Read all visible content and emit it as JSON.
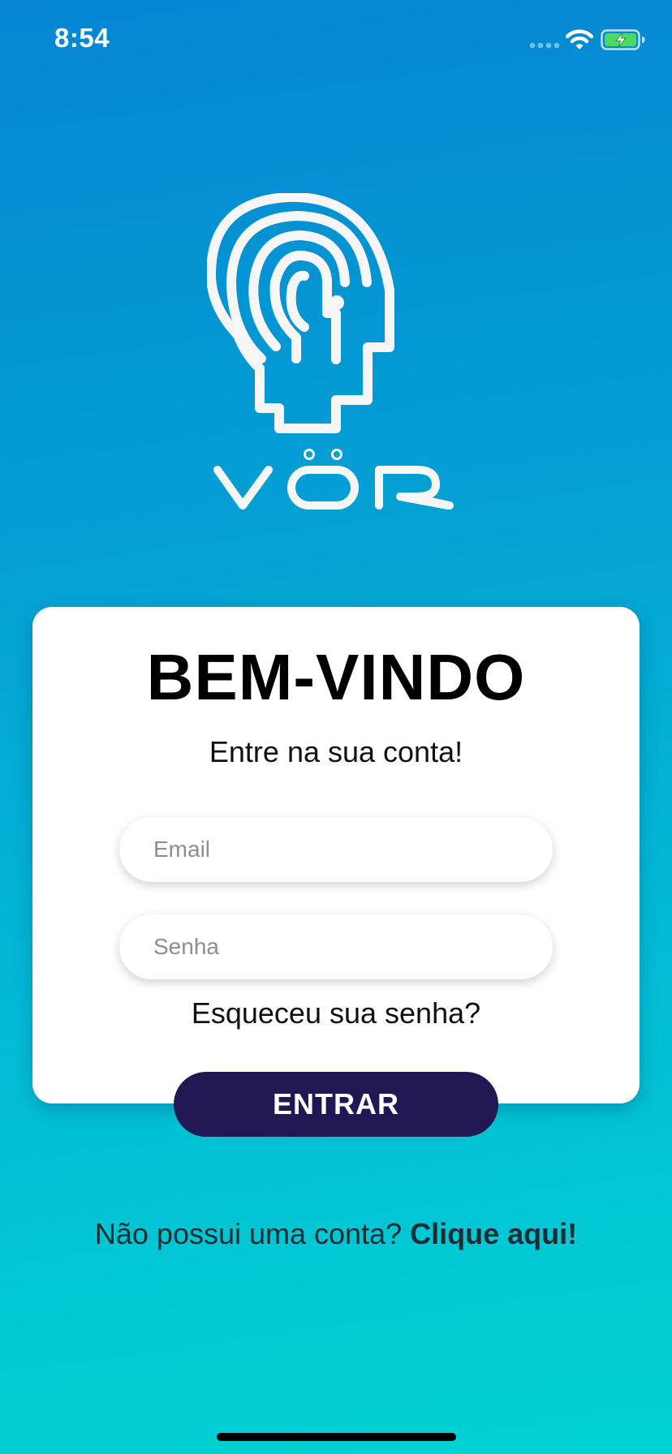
{
  "status_bar": {
    "time": "8:54"
  },
  "logo": {
    "icon": "head-fingerprint-logo",
    "wordmark": "VÖR"
  },
  "card": {
    "title": "BEM-VINDO",
    "subtitle": "Entre na sua conta!",
    "email": {
      "value": "",
      "placeholder": "Email"
    },
    "password": {
      "value": "",
      "placeholder": "Senha"
    },
    "forgot_password": "Esqueceu sua senha?",
    "login_button": "ENTRAR"
  },
  "signup": {
    "prompt": "Não possui uma conta?",
    "link": "Clique aqui!"
  },
  "colors": {
    "gradient_top": "#0585d2",
    "gradient_bottom": "#01d3d3",
    "button": "#201753",
    "battery_charge": "#4cd964"
  }
}
